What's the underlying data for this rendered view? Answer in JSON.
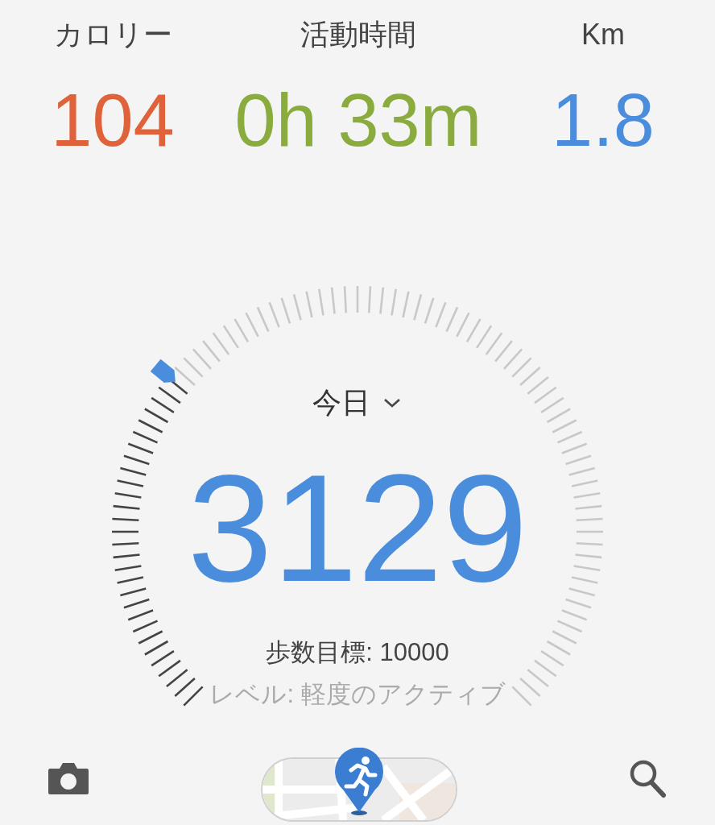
{
  "stats": [
    {
      "label": "カロリー",
      "value": "104",
      "color": "#e0623a"
    },
    {
      "label": "活動時間",
      "value": "0h 33m",
      "color": "#8aac3f"
    },
    {
      "label": "Km",
      "value": "1.8",
      "color": "#4a8ddc"
    }
  ],
  "gauge": {
    "period": "今日",
    "steps": "3129",
    "goal": "歩数目標: 10000",
    "activity_level": "レベル: 軽度のアクティブ"
  }
}
